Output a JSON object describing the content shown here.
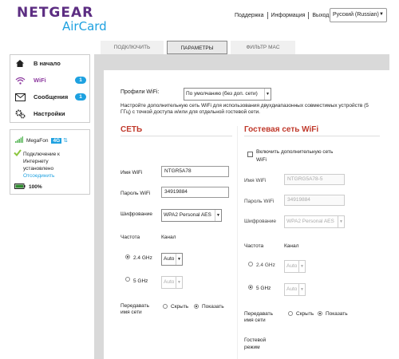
{
  "brand": {
    "name": "NETGEAR",
    "product": "AirCard"
  },
  "header": {
    "links": [
      "Поддержка",
      "Информация",
      "Выход"
    ],
    "language": "Русский (Russian)"
  },
  "tabs": [
    "ПОДКЛЮЧИТЬ",
    "ПАРАМЕТРЫ",
    "ФИЛЬТР MAC"
  ],
  "sidebar": {
    "items": [
      {
        "label": "В начало",
        "icon": "home-icon",
        "badge": ""
      },
      {
        "label": "WiFi",
        "icon": "wifi-icon",
        "badge": "1"
      },
      {
        "label": "Сообщения",
        "icon": "envelope-icon",
        "badge": "1"
      },
      {
        "label": "Настройки",
        "icon": "gears-icon",
        "badge": ""
      }
    ]
  },
  "status": {
    "carrier": "MegaFon",
    "network": "4G",
    "connection_lines": [
      "Подключение к",
      "Интернету",
      "установлено"
    ],
    "disconnect": "Отсоединить",
    "battery": "100%"
  },
  "profile": {
    "label": "Профили WiFi:",
    "value": "По умолчанию (без доп. сети)",
    "description": "Настройте дополнительную сеть WiFi для использования двухдиапазонных совместимых устройств (5 ГГц) с точкой доступа и/или для отдельной гостевой сети."
  },
  "main_network": {
    "title": "СЕТЬ",
    "wifi_name_label": "Имя WiFi",
    "wifi_name": "NTGR5A78",
    "password_label": "Пароль WiFi",
    "password": "34919884",
    "encryption_label": "Шифрование",
    "encryption": "WPA2 Personal AES",
    "frequency_label": "Частота",
    "channel_label": "Канал",
    "freq_24": "2.4 GHz",
    "freq_5": "5 GHz",
    "channel_24": "Auto",
    "channel_5": "Auto",
    "broadcast_label_1": "Передавать",
    "broadcast_label_2": "имя сети",
    "hide": "Скрыть",
    "show": "Показать"
  },
  "guest_network": {
    "title": "Гостевая сеть WiFi",
    "enable_line_1": "Включить дополнительную сеть",
    "enable_line_2": "WiFi",
    "wifi_name_label": "Имя WiFi",
    "wifi_name": "NTGRG5A78-5",
    "password_label": "Пароль WiFi",
    "password": "34919884",
    "encryption_label": "Шифрование",
    "encryption": "WPA2 Personal AES",
    "frequency_label": "Частота",
    "channel_label": "Канал",
    "freq_24": "2.4 GHz",
    "freq_5": "5 GHz",
    "channel_24": "Auto",
    "channel_5": "Auto",
    "broadcast_label_1": "Передавать",
    "broadcast_label_2": "имя сети",
    "hide": "Скрыть",
    "show": "Показать",
    "guest_mode_1": "Гостевой",
    "guest_mode_2": "режим"
  },
  "colors": {
    "brand_purple": "#5c2d82",
    "accent_blue": "#1ea1e0",
    "title_red": "#c0392b"
  }
}
